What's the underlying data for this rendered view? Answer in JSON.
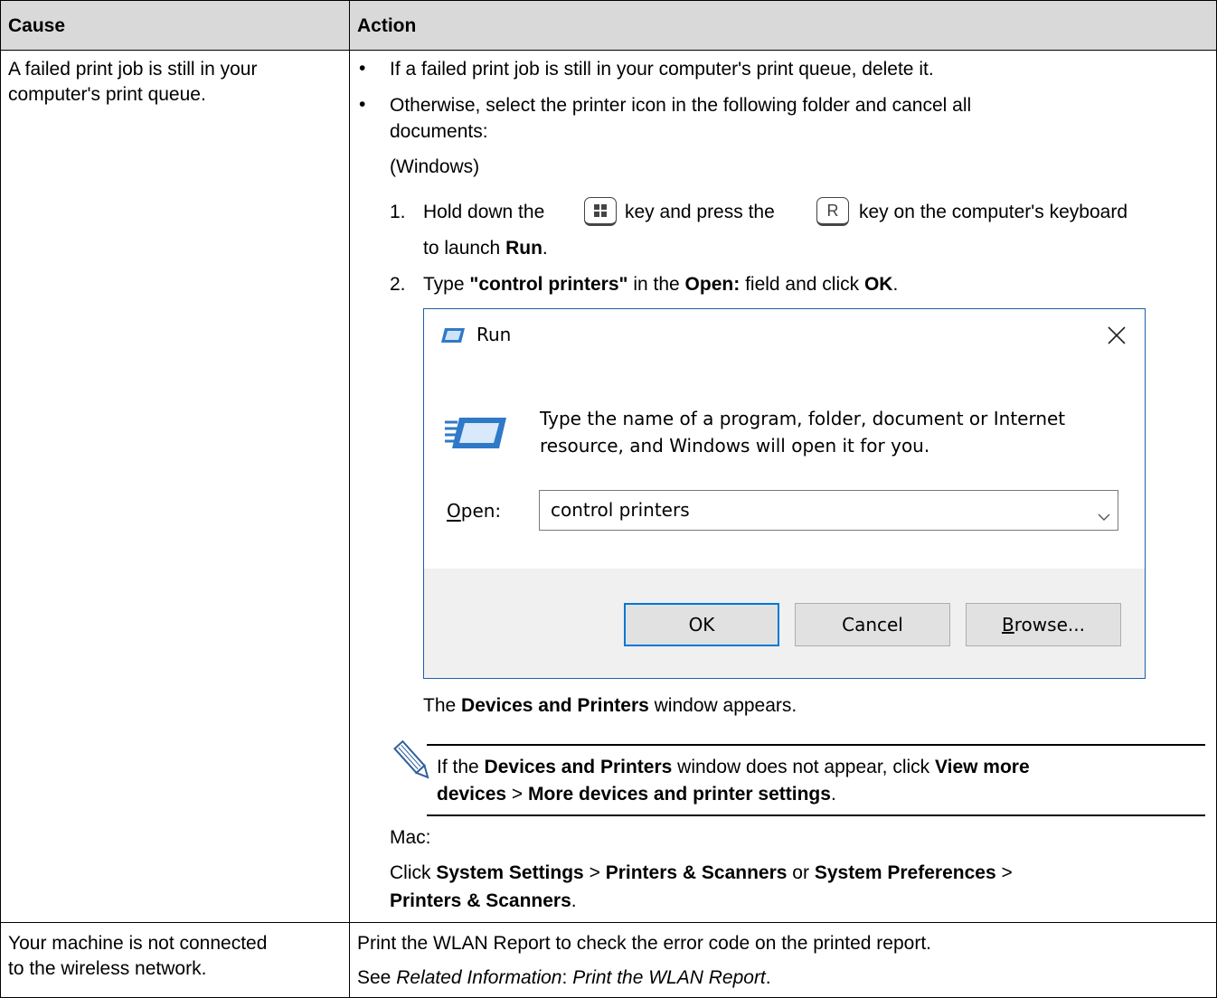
{
  "table": {
    "headers": {
      "cause": "Cause",
      "action": "Action"
    },
    "row1": {
      "cause_lines": [
        "A failed print job is still in your",
        "computer's print queue."
      ],
      "bullet_1": "If a failed print job is still in your computer's print queue, delete it.",
      "bullet_2_lines": [
        "Otherwise, select the printer icon in the following folder and cancel all",
        "documents:"
      ],
      "windows_label": "(Windows)",
      "step1": {
        "num": "1.",
        "text_a": "Hold down the",
        "text_b": "key and press the",
        "key_r": "R",
        "text_c": "key on the computer's keyboard",
        "text_d": "to launch",
        "bold_run": "Run",
        "text_e": "."
      },
      "step2": {
        "num": "2.",
        "text_a": "Type",
        "bold_cmd": "\"control printers\"",
        "text_b": "in the",
        "bold_open": "Open:",
        "text_c": "field and click",
        "bold_ok": "OK",
        "text_d": "."
      },
      "run_dialog": {
        "title": "Run",
        "description_lines": [
          "Type the name of a program, folder, document or Internet",
          "resource, and Windows will open it for you."
        ],
        "open_label": "Open:",
        "open_value": "control printers",
        "ok_label": "OK",
        "cancel_label": "Cancel",
        "browse_label": "Browse...",
        "accent_color": "#1f5fa8"
      },
      "after_dialog": {
        "text_a": "The",
        "bold": "Devices and Printers",
        "text_b": "window appears."
      },
      "note": {
        "text_a": "If the",
        "bold_1": "Devices and Printers",
        "text_b": "window does not appear, click",
        "bold_2a": "View more",
        "bold_2b": "devices",
        "text_c": ">",
        "bold_3": "More devices and printer settings",
        "text_d": "."
      },
      "mac_label": "Mac:",
      "mac": {
        "text_a": "Click",
        "bold_1": "System Settings",
        "sep_1": ">",
        "bold_2": "Printers & Scanners",
        "text_or": "or",
        "bold_3": "System Preferences",
        "sep_2": ">",
        "bold_4": "Printers & Scanners",
        "text_end": "."
      }
    },
    "row2": {
      "cause_lines": [
        "Your machine is not connected",
        "to the wireless network."
      ],
      "action_line_1": "Print the WLAN Report to check the error code on the printed report.",
      "see": "See",
      "related": "Related Information",
      "colon": ":",
      "link": "Print the WLAN Report",
      "period": "."
    }
  }
}
